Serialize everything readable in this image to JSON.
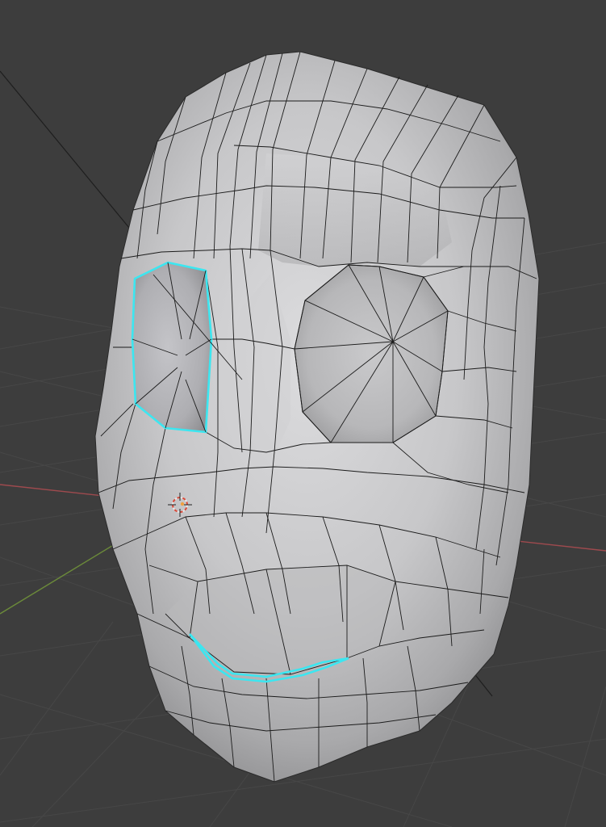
{
  "viewport": {
    "mode": "edit-mode",
    "object": "face-mesh",
    "colors": {
      "background": "#3d3d3d",
      "grid_line": "#474747",
      "x_axis": "#9e4a4e",
      "y_axis": "#6b8a3a",
      "mesh_fill": "#c6c6c8",
      "wire": "#1b1b1b",
      "selection": "#3ce6f0",
      "cursor": "#d94a3a"
    },
    "selected_edge_loops": [
      "left-eye-socket-loop",
      "mouth-loop"
    ]
  }
}
